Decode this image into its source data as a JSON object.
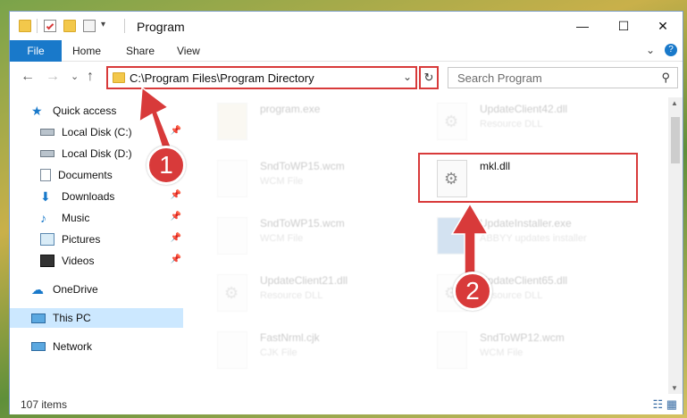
{
  "window": {
    "title": "Program",
    "minimize": "—",
    "maximize": "☐",
    "close": "✕"
  },
  "ribbon": {
    "file": "File",
    "home": "Home",
    "share": "Share",
    "view": "View",
    "collapse": "⌄",
    "help": "?"
  },
  "nav": {
    "back": "←",
    "forward": "→",
    "recent": "⌄",
    "up": "↑",
    "address": "C:\\Program Files\\Program Directory",
    "address_chevron": "⌄",
    "refresh": "↻",
    "search_placeholder": "Search Program",
    "search_icon": "⚲"
  },
  "sidebar": {
    "items": [
      {
        "label": "Quick access",
        "icon": "star-icon"
      },
      {
        "label": "Local Disk (C:)",
        "icon": "drive-icon"
      },
      {
        "label": "Local Disk (D:)",
        "icon": "drive-icon"
      },
      {
        "label": "Documents",
        "icon": "documents-icon"
      },
      {
        "label": "Downloads",
        "icon": "download-icon"
      },
      {
        "label": "Music",
        "icon": "music-icon"
      },
      {
        "label": "Pictures",
        "icon": "pictures-icon"
      },
      {
        "label": "Videos",
        "icon": "videos-icon"
      },
      {
        "label": "OneDrive",
        "icon": "cloud-icon"
      },
      {
        "label": "This PC",
        "icon": "computer-icon"
      },
      {
        "label": "Network",
        "icon": "network-icon"
      }
    ],
    "pin": "📌"
  },
  "files": [
    {
      "name": "program.exe",
      "type": ""
    },
    {
      "name": "UpdateClient42.dll",
      "type": "Resource DLL"
    },
    {
      "name": "SndToWP15.wcm",
      "type": "WCM File"
    },
    {
      "name": "mkl.dll",
      "type": ""
    },
    {
      "name": "SndToWP15.wcm",
      "type": "WCM File"
    },
    {
      "name": "UpdateInstaller.exe",
      "type": "ABBYY updates installer"
    },
    {
      "name": "UpdateClient21.dll",
      "type": "Resource DLL"
    },
    {
      "name": "UpdateClient65.dll",
      "type": "Resource DLL"
    },
    {
      "name": "FastNrml.cjk",
      "type": "CJK File"
    },
    {
      "name": "SndToWP12.wcm",
      "type": "WCM File"
    }
  ],
  "status": {
    "items_count": "107 items",
    "view_icons": "☷ ▦"
  },
  "annotations": {
    "step1": "1",
    "step2": "2"
  },
  "colors": {
    "accent": "#1979ca",
    "highlight": "#d83a3a",
    "selection": "#cce8ff"
  }
}
